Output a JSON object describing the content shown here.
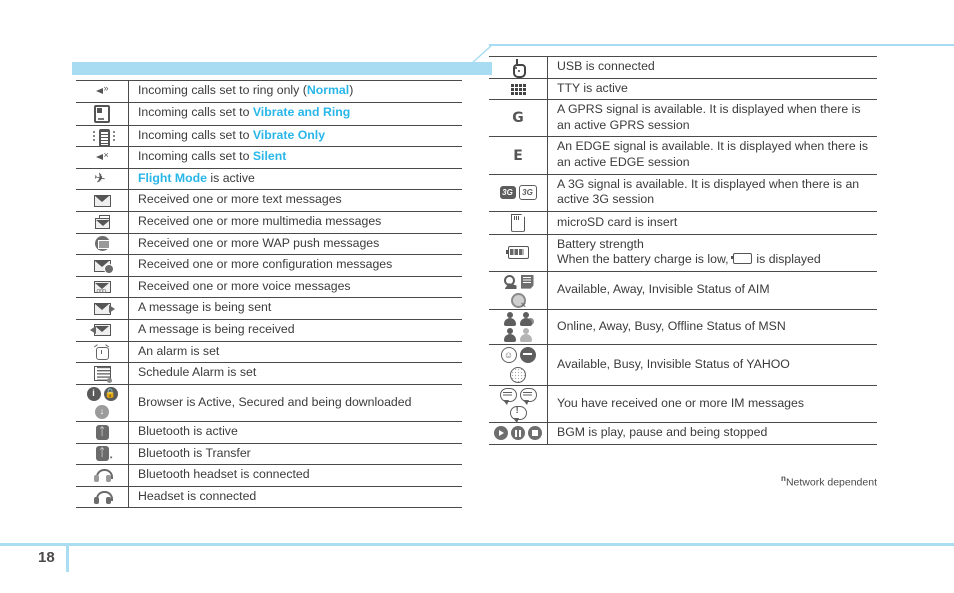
{
  "page": {
    "number": "18",
    "footnote_marker": "n",
    "footnote_text": "Network dependent",
    "accent_color": "#aadcf2",
    "highlight_color": "#29b6e8"
  },
  "left_table": {
    "rows": [
      {
        "icon": "speaker-ring-icon",
        "text_pre": "Incoming calls set to ring only (",
        "highlight": "Normal",
        "text_post": ")"
      },
      {
        "icon": "vibrate-and-ring-icon",
        "text_pre": "Incoming calls set to ",
        "highlight": "Vibrate and Ring",
        "text_post": ""
      },
      {
        "icon": "vibrate-only-icon",
        "text_pre": "Incoming calls set to ",
        "highlight": "Vibrate Only",
        "text_post": ""
      },
      {
        "icon": "speaker-mute-icon",
        "text_pre": "Incoming calls set to ",
        "highlight": "Silent",
        "text_post": ""
      },
      {
        "icon": "airplane-icon",
        "text_pre": "",
        "highlight": "Flight Mode",
        "text_post": " is active"
      },
      {
        "icon": "envelope-text-message-icon",
        "text_pre": "Received one or more text messages",
        "highlight": "",
        "text_post": ""
      },
      {
        "icon": "envelope-multimedia-icon",
        "text_pre": "Received one or more multimedia messages",
        "highlight": "",
        "text_post": ""
      },
      {
        "icon": "wap-push-icon",
        "text_pre": "Received one or more WAP push messages",
        "highlight": "",
        "text_post": ""
      },
      {
        "icon": "envelope-configuration-icon",
        "text_pre": "Received one or more configuration messages",
        "highlight": "",
        "text_post": ""
      },
      {
        "icon": "envelope-voice-icon",
        "text_pre": "Received one or more voice messages",
        "highlight": "",
        "text_post": ""
      },
      {
        "icon": "message-sending-icon",
        "text_pre": "A message is being sent",
        "highlight": "",
        "text_post": ""
      },
      {
        "icon": "message-receiving-icon",
        "text_pre": "A message is being received",
        "highlight": "",
        "text_post": ""
      },
      {
        "icon": "alarm-clock-icon",
        "text_pre": "An alarm is set",
        "highlight": "",
        "text_post": ""
      },
      {
        "icon": "schedule-alarm-icon",
        "text_pre": "Schedule Alarm is set",
        "highlight": "",
        "text_post": ""
      },
      {
        "icon": "browser-status-icons",
        "text_pre": "Browser is Active, Secured and being downloaded",
        "highlight": "",
        "text_post": ""
      },
      {
        "icon": "bluetooth-active-icon",
        "text_pre": "Bluetooth is active",
        "highlight": "",
        "text_post": ""
      },
      {
        "icon": "bluetooth-transfer-icon",
        "text_pre": "Bluetooth is Transfer",
        "highlight": "",
        "text_post": ""
      },
      {
        "icon": "bluetooth-headset-icon",
        "text_pre": "Bluetooth headset is connected",
        "highlight": "",
        "text_post": ""
      },
      {
        "icon": "headset-icon",
        "text_pre": "Headset is connected",
        "highlight": "",
        "text_post": ""
      }
    ]
  },
  "right_table": {
    "rows": [
      {
        "icon": "usb-icon",
        "text": "USB is connected"
      },
      {
        "icon": "tty-icon",
        "text": "TTY is active"
      },
      {
        "icon": "gprs-signal-icon",
        "text": "A GPRS signal is available. It is displayed when there is an active GPRS session"
      },
      {
        "icon": "edge-signal-icon",
        "text": "An EDGE signal is available. It is displayed when there is an active EDGE session"
      },
      {
        "icon": "three-g-signal-icon",
        "text": "A 3G signal is available. It is displayed when there is an active 3G session"
      },
      {
        "icon": "microsd-card-icon",
        "text": "microSD card is insert"
      },
      {
        "icon": "battery-icon",
        "text_line1": "Battery strength",
        "text_line2_pre": "When the battery charge is low, ",
        "text_line2_post": " is displayed",
        "inline_icon": "battery-low-icon"
      },
      {
        "icon": "aim-status-icons",
        "text": "Available, Away, Invisible Status of AIM"
      },
      {
        "icon": "msn-status-icons",
        "text": "Online, Away, Busy, Offline Status of MSN"
      },
      {
        "icon": "yahoo-status-icons",
        "text": "Available, Busy, Invisible Status of YAHOO"
      },
      {
        "icon": "im-message-icons",
        "text": "You have received one or more IM messages"
      },
      {
        "icon": "bgm-status-icons",
        "text": "BGM is play, pause and being stopped"
      }
    ],
    "letter_gprs": "G",
    "letter_edge": "E",
    "label_3g": "3G"
  }
}
